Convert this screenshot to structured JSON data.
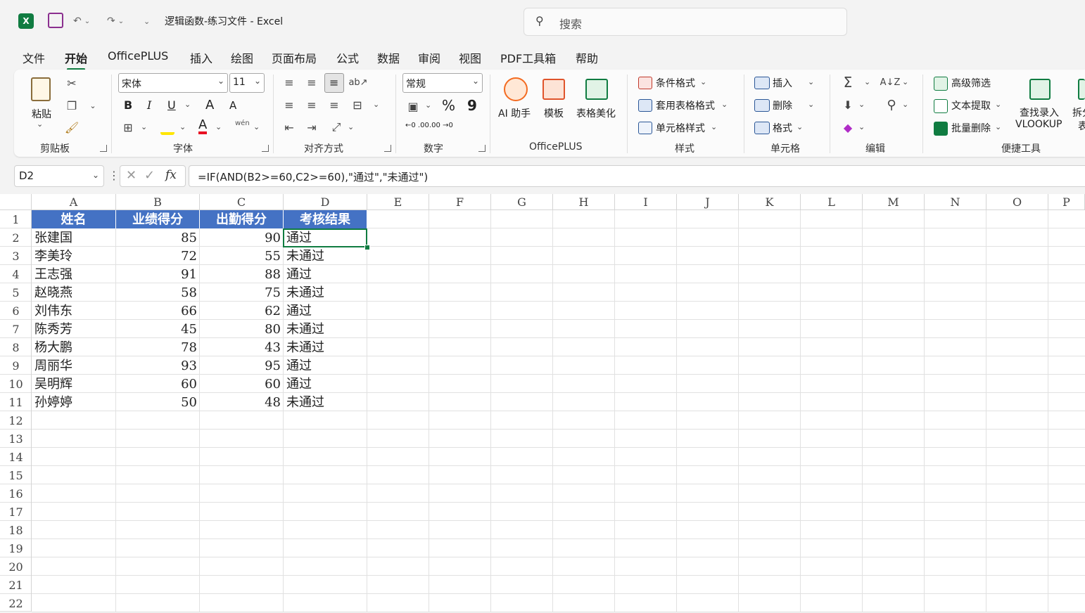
{
  "titlebar": {
    "app_icon": "excel-logo",
    "doc_title": "逻辑函数-练习文件 - Excel",
    "search_placeholder": "搜索"
  },
  "menu": [
    "文件",
    "开始",
    "OfficePLUS",
    "插入",
    "绘图",
    "页面布局",
    "公式",
    "数据",
    "审阅",
    "视图",
    "PDF工具箱",
    "帮助"
  ],
  "menu_active": "开始",
  "ribbon": {
    "clipboard": {
      "paste": "粘贴",
      "group": "剪贴板"
    },
    "font": {
      "name": "宋体",
      "size": "11",
      "group": "字体",
      "bold": "B",
      "italic": "I",
      "underline": "U",
      "grow": "A",
      "shrink": "A",
      "phonetic": "wén"
    },
    "align": {
      "group": "对齐方式"
    },
    "number": {
      "format": "常规",
      "percent": "%",
      "comma": "9",
      "group": "数字",
      "inc_decimal": "←0 .00",
      "dec_decimal": ".00 →0"
    },
    "officeplus": {
      "ai": "AI 助手",
      "template": "模板",
      "beautify": "表格美化",
      "group": "OfficePLUS"
    },
    "styles": {
      "conditional": "条件格式",
      "table": "套用表格格式",
      "cell": "单元格样式",
      "group": "样式"
    },
    "cells": {
      "insert": "插入",
      "delete": "删除",
      "format": "格式",
      "group": "单元格"
    },
    "editing": {
      "group": "编辑"
    },
    "tools": {
      "filter": "高级筛选",
      "extract": "文本提取",
      "batch_delete": "批量删除",
      "lookup": "查找录入",
      "lookup2": "VLOOKUP",
      "split": "拆分",
      "split2": "表",
      "group": "便捷工具"
    }
  },
  "formula_bar": {
    "cell_ref": "D2",
    "fx": "fx",
    "formula": "=IF(AND(B2>=60,C2>=60),\"通过\",\"未通过\")"
  },
  "sheet": {
    "columns": [
      "A",
      "B",
      "C",
      "D",
      "E",
      "F",
      "G",
      "H",
      "I",
      "J",
      "K",
      "L",
      "M",
      "N",
      "O",
      "P"
    ],
    "rows": [
      "1",
      "2",
      "3",
      "4",
      "5",
      "6",
      "7",
      "8",
      "9",
      "10",
      "11",
      "12",
      "13",
      "14",
      "15",
      "16",
      "17",
      "18",
      "19",
      "20",
      "21",
      "22"
    ],
    "header": [
      "姓名",
      "业绩得分",
      "出勤得分",
      "考核结果"
    ],
    "data": [
      [
        "张建国",
        "85",
        "90",
        "通过"
      ],
      [
        "李美玲",
        "72",
        "55",
        "未通过"
      ],
      [
        "王志强",
        "91",
        "88",
        "通过"
      ],
      [
        "赵晓燕",
        "58",
        "75",
        "未通过"
      ],
      [
        "刘伟东",
        "66",
        "62",
        "通过"
      ],
      [
        "陈秀芳",
        "45",
        "80",
        "未通过"
      ],
      [
        "杨大鹏",
        "78",
        "43",
        "未通过"
      ],
      [
        "周丽华",
        "93",
        "95",
        "通过"
      ],
      [
        "吴明辉",
        "60",
        "60",
        "通过"
      ],
      [
        "孙婷婷",
        "50",
        "48",
        "未通过"
      ]
    ],
    "selected_cell": "D2",
    "header_color": "#4472c4",
    "accent_color": "#107c41"
  }
}
